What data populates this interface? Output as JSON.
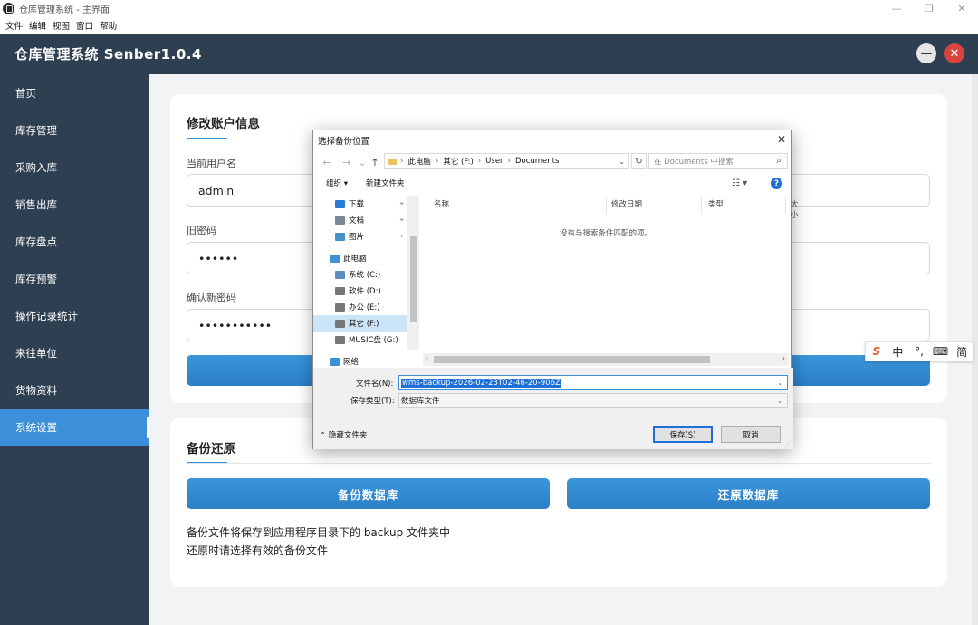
{
  "os": {
    "window_title": "仓库管理系统 - 主界面",
    "minimize": "—",
    "maximize": "❐",
    "close": "✕"
  },
  "menu": [
    "文件",
    "编辑",
    "视图",
    "窗口",
    "帮助"
  ],
  "header": {
    "title": "仓库管理系统 Senber1.0.4",
    "minimize": "—",
    "close": "✕"
  },
  "sidebar": {
    "items": [
      {
        "label": "首页",
        "active": false
      },
      {
        "label": "库存管理",
        "active": false
      },
      {
        "label": "采购入库",
        "active": false
      },
      {
        "label": "销售出库",
        "active": false
      },
      {
        "label": "库存盘点",
        "active": false
      },
      {
        "label": "库存预警",
        "active": false
      },
      {
        "label": "操作记录统计",
        "active": false
      },
      {
        "label": "来往单位",
        "active": false
      },
      {
        "label": "货物资料",
        "active": false
      },
      {
        "label": "系统设置",
        "active": true
      }
    ]
  },
  "account": {
    "title": "修改账户信息",
    "username_label": "当前用户名",
    "username_value": "admin",
    "old_password_label": "旧密码",
    "old_password_value": "••••••",
    "confirm_password_label": "确认新密码",
    "confirm_password_value": "•••••••••••"
  },
  "backup": {
    "title": "备份还原",
    "backup_button": "备份数据库",
    "restore_button": "还原数据库",
    "note1": "备份文件将保存到应用程序目录下的 backup 文件夹中",
    "note2": "还原时请选择有效的备份文件"
  },
  "ime": {
    "logo": "S",
    "lang": "中",
    "punct": "°,",
    "keyboard": "⌨",
    "mode": "简"
  },
  "dialog": {
    "title": "选择备份位置",
    "close": "✕",
    "nav": {
      "back": "←",
      "forward": "→",
      "recent": "⌄",
      "up": "↑"
    },
    "path": [
      "此电脑",
      "其它 (F:)",
      "User",
      "Documents"
    ],
    "path_sep": "›",
    "refresh": "↻",
    "search_placeholder": "在 Documents 中搜索",
    "search_icon": "⌕",
    "toolbar": {
      "organize": "组织 ▾",
      "new_folder": "新建文件夹",
      "view": "☷ ▾",
      "help": "?"
    },
    "nav_items": [
      {
        "label": "下载",
        "pinned": true,
        "icon": "download-icon",
        "indent": 24,
        "color": "#2a7bd4",
        "selected": false
      },
      {
        "label": "文档",
        "pinned": true,
        "icon": "document-icon",
        "indent": 24,
        "color": "#7a8796",
        "selected": false
      },
      {
        "label": "图片",
        "pinned": true,
        "icon": "pictures-icon",
        "indent": 24,
        "color": "#4a90c8",
        "selected": false
      },
      {
        "label": "此电脑",
        "pinned": false,
        "icon": "computer-icon",
        "indent": 18,
        "color": "#3f8fd6",
        "selected": false
      },
      {
        "label": "系统 (C:)",
        "pinned": false,
        "icon": "drive-icon",
        "indent": 24,
        "color": "#5c8fbf",
        "selected": false
      },
      {
        "label": "软件 (D:)",
        "pinned": false,
        "icon": "drive-icon",
        "indent": 24,
        "color": "#777777",
        "selected": false
      },
      {
        "label": "办公 (E:)",
        "pinned": false,
        "icon": "drive-icon",
        "indent": 24,
        "color": "#777777",
        "selected": false
      },
      {
        "label": "其它 (F:)",
        "pinned": false,
        "icon": "drive-icon",
        "indent": 24,
        "color": "#777777",
        "selected": true
      },
      {
        "label": "MUSIC盘 (G:)",
        "pinned": false,
        "icon": "drive-icon",
        "indent": 24,
        "color": "#777777",
        "selected": false
      },
      {
        "label": "网络",
        "pinned": false,
        "icon": "network-icon",
        "indent": 18,
        "color": "#3f8fd6",
        "selected": false
      }
    ],
    "columns": [
      "名称",
      "修改日期",
      "类型",
      "大小"
    ],
    "empty_message": "没有与搜索条件匹配的项。",
    "filename_label": "文件名(N):",
    "filename_value": "wms-backup-2026-02-23T02-46-20-906Z",
    "filetype_label": "保存类型(T):",
    "filetype_value": "数据库文件",
    "hide_folders": "⌃ 隐藏文件夹",
    "save_button": "保存(S)",
    "cancel_button": "取消"
  }
}
